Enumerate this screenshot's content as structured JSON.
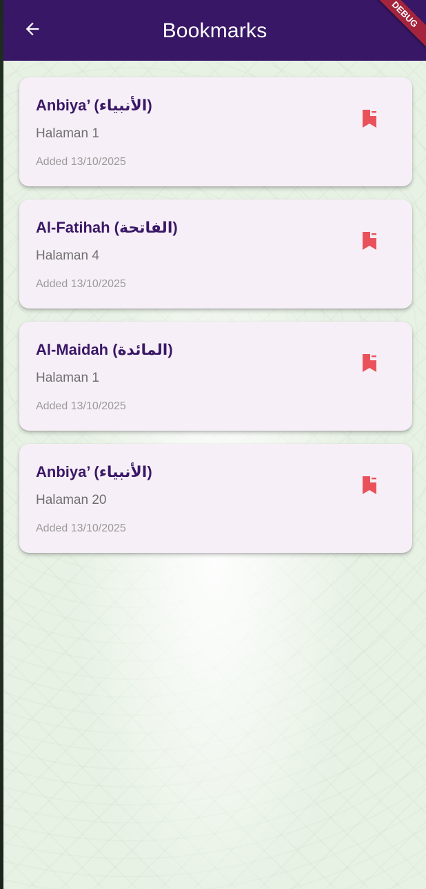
{
  "app_bar": {
    "title": "Bookmarks",
    "back_icon": "arrow-left-icon",
    "background_color": "#381766"
  },
  "debug_banner": "DEBUG",
  "bookmarks": [
    {
      "title": "Anbiya’ (الأنبياء)",
      "page": "Halaman 1",
      "added": "Added 13/10/2025",
      "action_icon": "bookmark-remove-icon"
    },
    {
      "title": "Al-Fatihah (الفاتحة)",
      "page": "Halaman 4",
      "added": "Added 13/10/2025",
      "action_icon": "bookmark-remove-icon"
    },
    {
      "title": "Al-Maidah (المائدة)",
      "page": "Halaman 1",
      "added": "Added 13/10/2025",
      "action_icon": "bookmark-remove-icon"
    },
    {
      "title": "Anbiya’ (الأنبياء)",
      "page": "Halaman 20",
      "added": "Added 13/10/2025",
      "action_icon": "bookmark-remove-icon"
    }
  ],
  "colors": {
    "accent": "#381766",
    "title_text": "#3a1866",
    "card_background": "#f7eff7",
    "remove_icon": "#e9525a"
  }
}
